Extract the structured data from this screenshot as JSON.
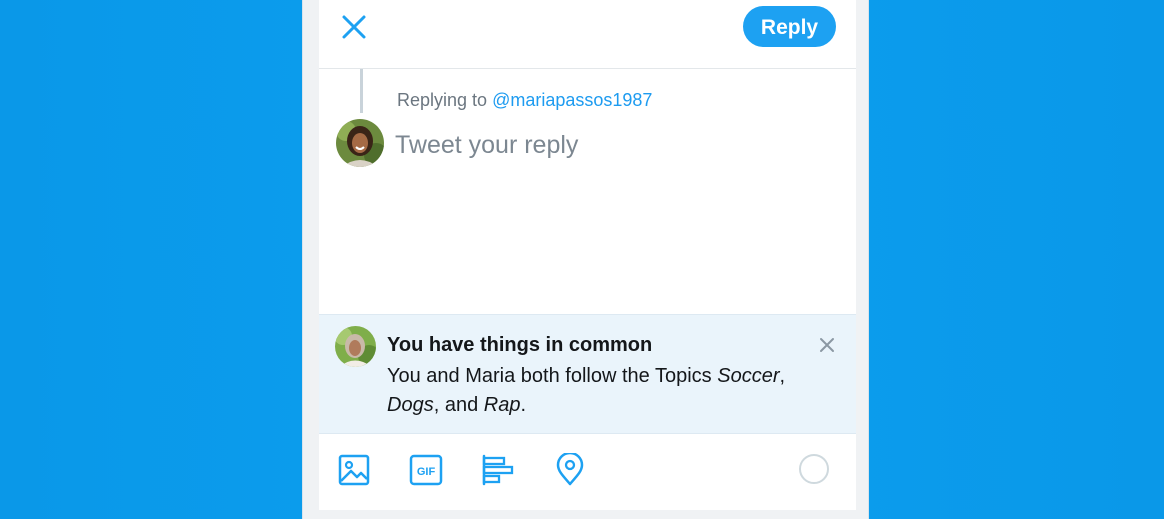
{
  "header": {
    "close_icon": "close-icon",
    "reply_label": "Reply"
  },
  "compose": {
    "replying_prefix": "Replying to",
    "replying_handle": "@mariapassos1987",
    "placeholder": "Tweet your reply",
    "value": ""
  },
  "banner": {
    "title": "You have things in common",
    "body_prefix": "You and Maria both follow the Topics",
    "topic_1": "Soccer",
    "sep_1": ",",
    "topic_2": "Dogs",
    "sep_2": ", and",
    "topic_3": "Rap",
    "end": "."
  },
  "toolbar": {
    "icons": [
      "image-icon",
      "gif-icon",
      "poll-icon",
      "location-icon"
    ],
    "gif_text": "GIF"
  },
  "colors": {
    "accent": "#1da1f2",
    "background": "#0b9cec",
    "banner_bg": "#eaf4fb"
  }
}
